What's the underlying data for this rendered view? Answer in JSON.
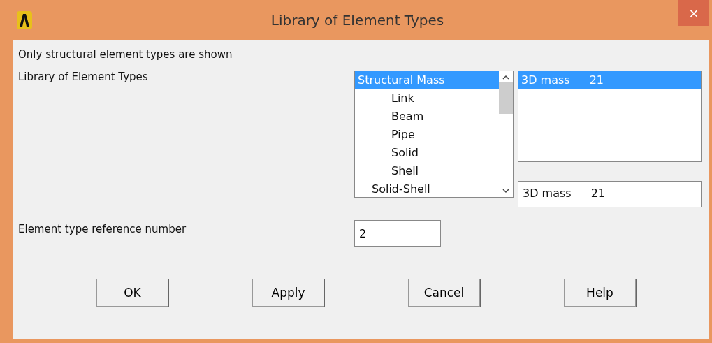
{
  "window": {
    "title": "Library of Element Types",
    "close": "×"
  },
  "note": "Only structural element types are shown",
  "library": {
    "label": "Library of Element Types",
    "categories": [
      {
        "label": "Structural Mass",
        "kind": "top",
        "selected": true
      },
      {
        "label": "Link",
        "kind": "sub",
        "selected": false
      },
      {
        "label": "Beam",
        "kind": "sub",
        "selected": false
      },
      {
        "label": "Pipe",
        "kind": "sub",
        "selected": false
      },
      {
        "label": "Solid",
        "kind": "sub",
        "selected": false
      },
      {
        "label": "Shell",
        "kind": "sub",
        "selected": false
      },
      {
        "label": "Solid-Shell",
        "kind": "group",
        "selected": false
      }
    ],
    "types": [
      {
        "name": "3D mass",
        "number": "21",
        "selected": true
      }
    ],
    "current": {
      "name": "3D mass",
      "number": "21"
    }
  },
  "reference": {
    "label": "Element type reference number",
    "value": "2"
  },
  "buttons": [
    "OK",
    "Apply",
    "Cancel",
    "Help"
  ]
}
